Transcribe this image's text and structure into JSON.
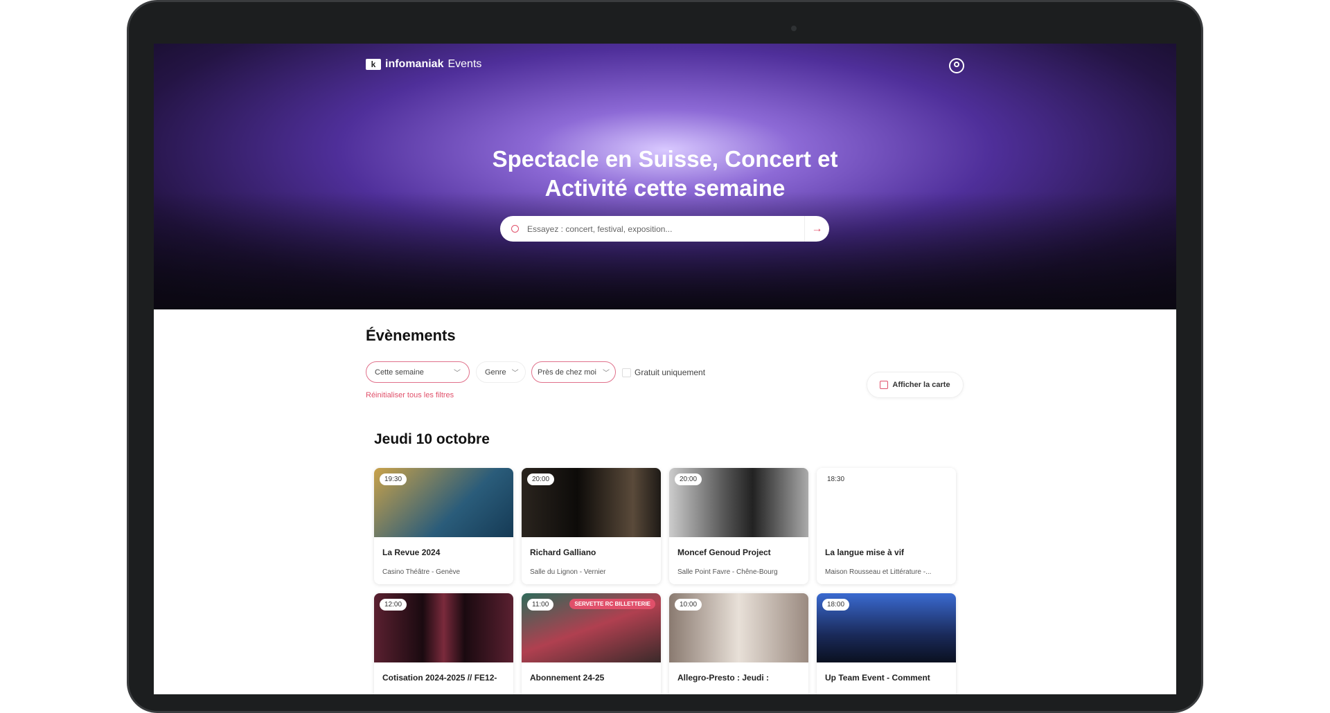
{
  "header": {
    "logo_brand": "infomaniak",
    "logo_product": "Events",
    "user_icon": "user-circle-icon"
  },
  "hero": {
    "title_line1": "Spectacle en Suisse, Concert et",
    "title_line2": "Activité cette semaine",
    "search_placeholder": "Essayez : concert, festival, exposition..."
  },
  "events": {
    "heading": "Évènements",
    "filters": {
      "period": "Cette semaine",
      "genre": "Genre",
      "location": "Près de chez moi",
      "free_only": "Gratuit uniquement",
      "free_only_checked": false,
      "reset": "Réinitialiser tous les filtres",
      "map_button": "Afficher la carte"
    },
    "day": "Jeudi 10 octobre",
    "cards": [
      {
        "time": "19:30",
        "title": "La Revue 2024",
        "venue": "Casino Théâtre - Genève",
        "bg": "linear-gradient(135deg,#c9a24a,#2a5c7a 60%,#153a55)"
      },
      {
        "time": "20:00",
        "title": "Richard Galliano",
        "venue": "Salle du Lignon - Vernier",
        "bg": "linear-gradient(90deg,#2a241e,#0d0b09 40%,#5a4a3a 80%,#1e1a16)"
      },
      {
        "time": "20:00",
        "title": "Moncef Genoud Project",
        "venue": "Salle Point Favre - Chêne-Bourg",
        "bg": "linear-gradient(90deg,#ccc,#555 40%,#222 60%,#aaa)"
      },
      {
        "time": "18:30",
        "title": "La langue mise à vif",
        "venue": "Maison Rousseau et Littérature -...",
        "bg": "#ffffff"
      },
      {
        "time": "12:00",
        "title": "Cotisation 2024-2025 // FE12-",
        "venue": "",
        "bg": "linear-gradient(90deg,#5a2030,#1a0a10 35%,#7a2a3c 50%,#1a0a10 65%,#5a2030)"
      },
      {
        "time": "11:00",
        "title": "Abonnement 24-25",
        "venue": "",
        "bg": "linear-gradient(160deg,#2e6a5a,#b04050 50%,#3a2a2a)",
        "tag": "SERVETTE RC BILLETTERIE"
      },
      {
        "time": "10:00",
        "title": "Allegro-Presto : Jeudi :",
        "venue": "",
        "bg": "linear-gradient(90deg,#8a7a70,#e8e0d8 50%,#9a8a80)"
      },
      {
        "time": "18:00",
        "title": "Up Team Event - Comment",
        "venue": "",
        "bg": "linear-gradient(180deg,#3a6ad0,#1a2a5a 60%,#0a1020)"
      }
    ]
  },
  "colors": {
    "accent": "#e0506a"
  }
}
